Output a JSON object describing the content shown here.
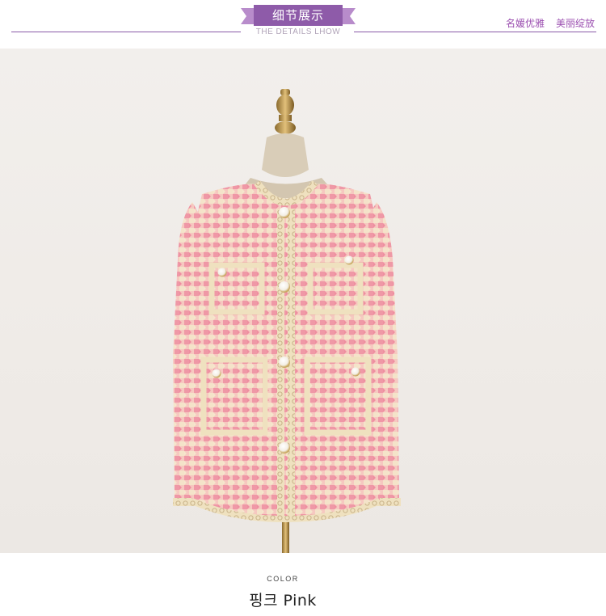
{
  "header": {
    "ribbon_title": "细节展示",
    "subtitle": "THE DETAILS LHOW",
    "slogans": [
      "名媛优雅",
      "美丽绽放"
    ]
  },
  "product_image": {
    "subject": "pink houndstooth tweed jacket on mannequin"
  },
  "caption": {
    "label": "COLOR",
    "value": "핑크 Pink"
  },
  "colors": {
    "accent": "#8a5aa8",
    "ribbon": "#8e5ba9",
    "slogan_text": "#9b4fb0",
    "jacket_pink": "#f2a2a8",
    "trim_cream": "#f1e6c8"
  }
}
